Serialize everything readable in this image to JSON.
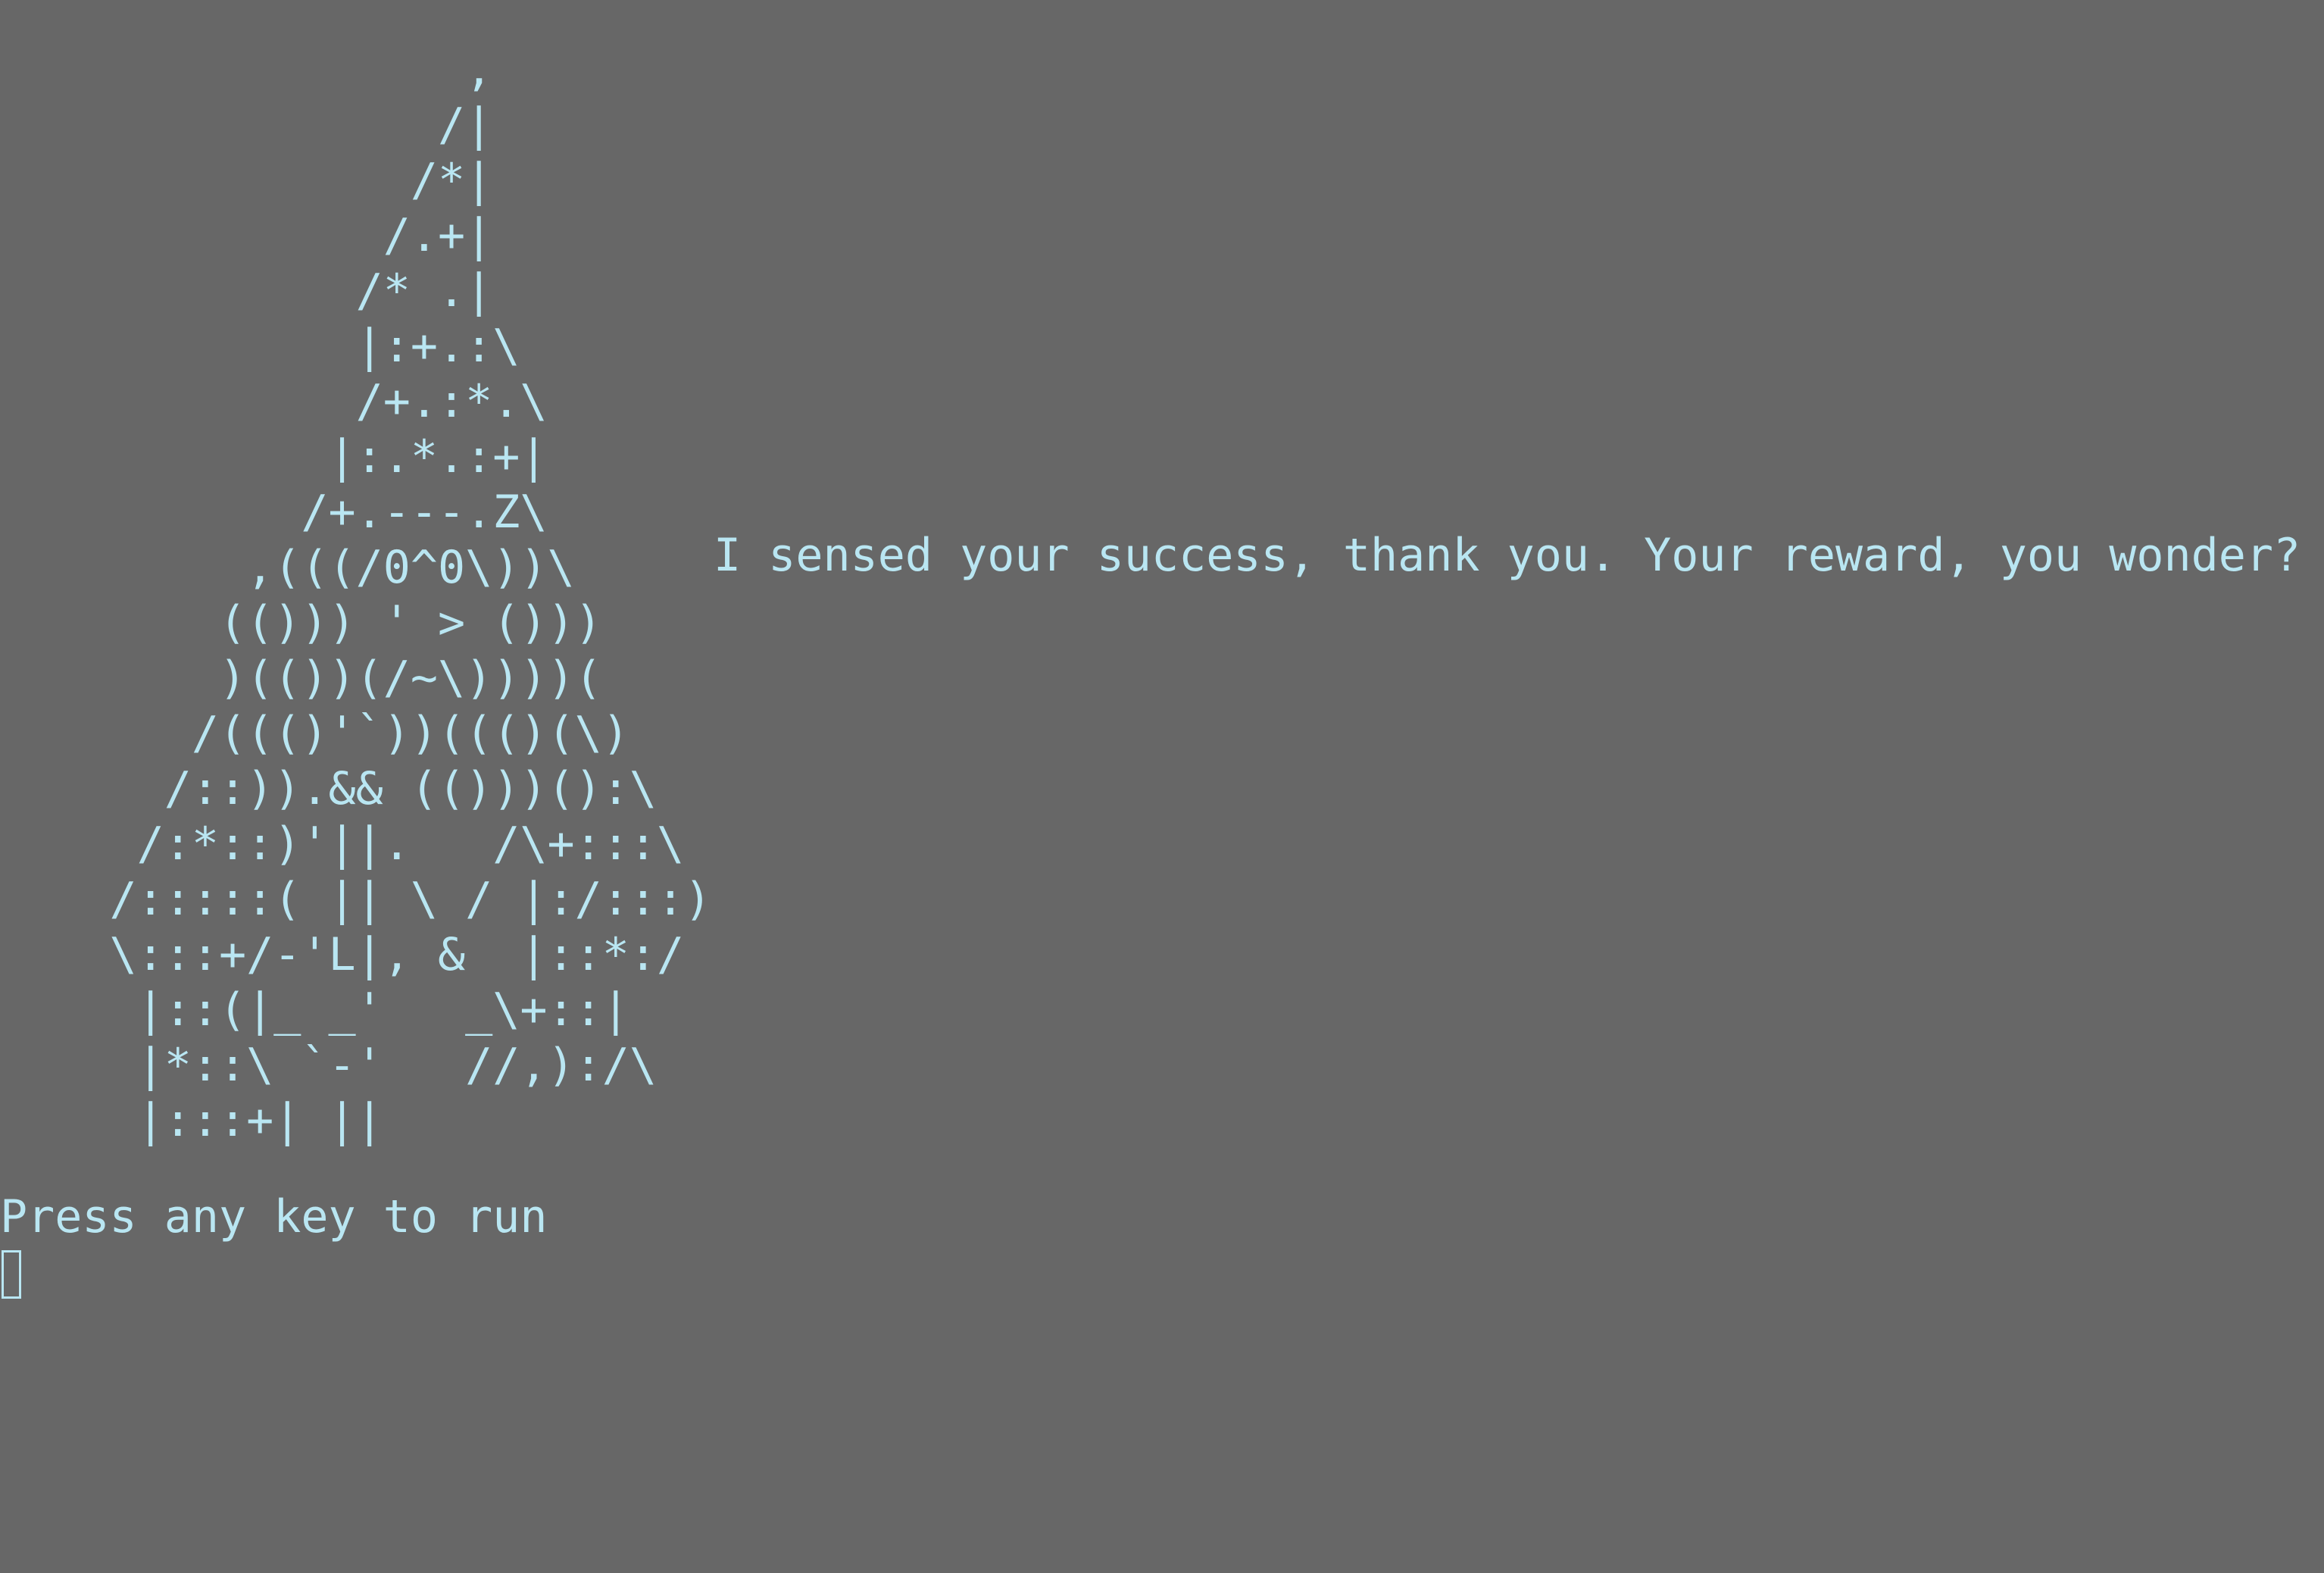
{
  "terminal": {
    "background": "#676767",
    "foreground": "#b9e6f2",
    "ascii_art_lines": [
      "                 ,",
      "                /|",
      "               /*|",
      "              /.+|",
      "             /* .|",
      "             |:+.:\\",
      "             /+.:*.\\",
      "            |:.*.:+|",
      "           /+.---.Z\\",
      "         ,(((/0^0\\))\\",
      "        (())) ' > ()))",
      "        )(())(/~\\))))(",
      "       /((()'`))((()(\\)",
      "      /::)).&& (()))():\\",
      "     /:*::)'||.   /\\+:::\\",
      "    /:::::( || \\ / |:/:::)",
      "    \\:::+/-'L|, &  |::*:/",
      "     |::(|_ _'   _\\+::|",
      "     |*::\\ `-'   //,):/\\",
      "     |:::+| ||"
    ],
    "speech": "I sensed your success, thank you. Your reward, you wonder?",
    "prompt": "Press any key to run"
  }
}
